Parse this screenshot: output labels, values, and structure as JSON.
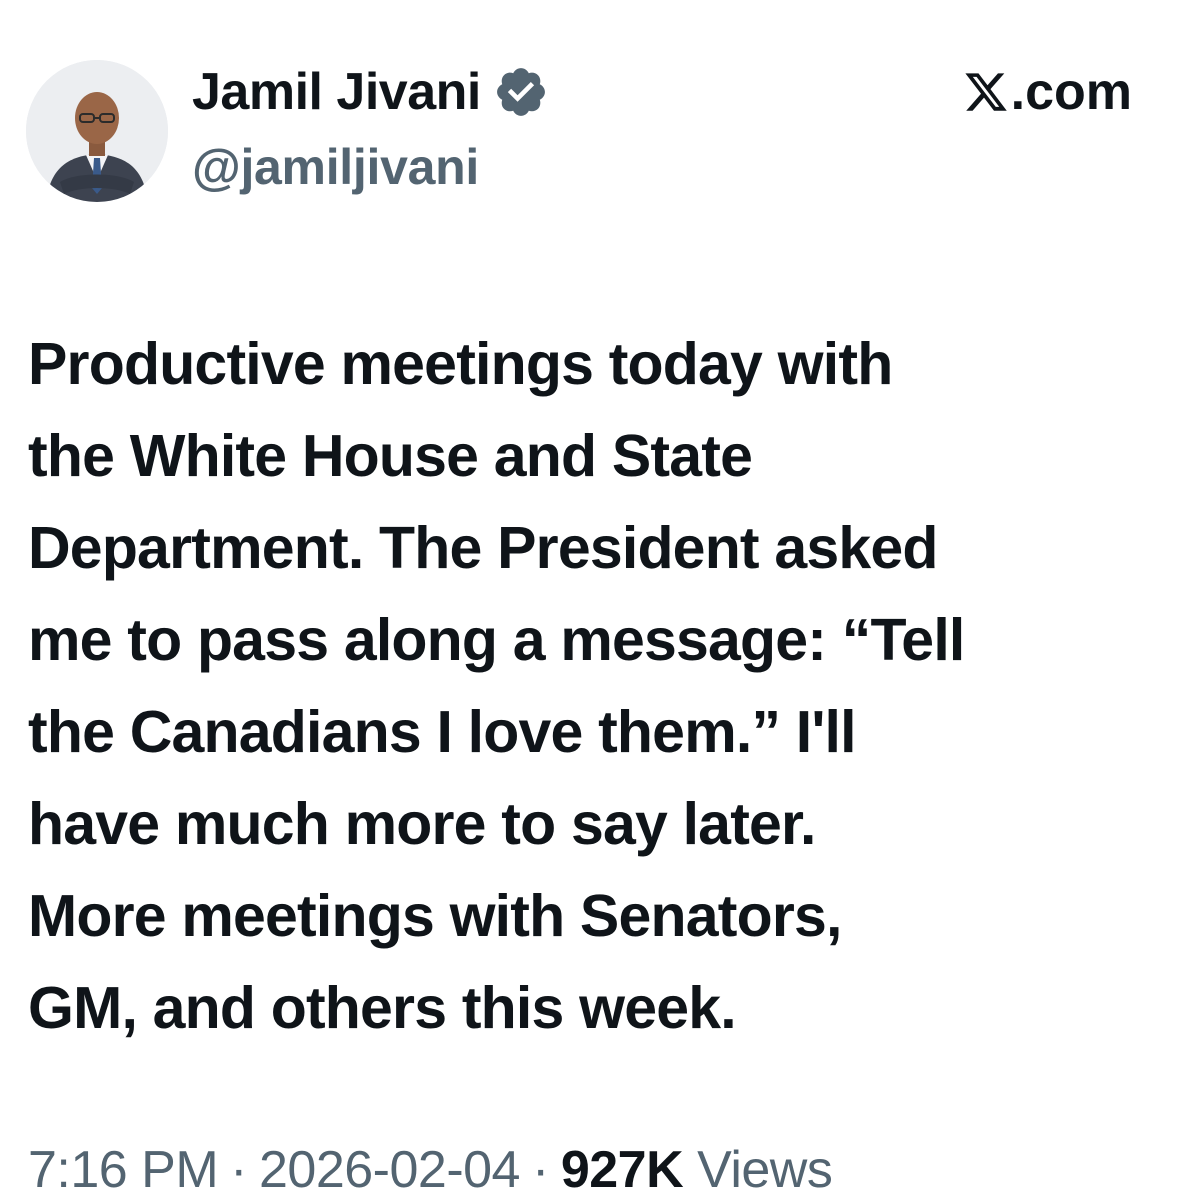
{
  "author": {
    "display_name": "Jamil Jivani",
    "handle": "@jamiljivani",
    "avatar_icon": "profile-photo",
    "verified_icon": "verified-badge-icon",
    "verified_color": "#536471"
  },
  "site": {
    "label": ".com",
    "logo_icon": "x-logo-icon"
  },
  "tweet": {
    "lines": [
      "Productive meetings today with",
      "the White House and State",
      "Department. The President asked",
      "me to pass along a message: “Tell",
      "the Canadians I love them.” I'll",
      "have much more to say later.",
      "More meetings with Senators,",
      "GM, and others this week."
    ]
  },
  "meta": {
    "time": "7:16 PM",
    "separator": "·",
    "date": "2026-02-04",
    "views_count": "927K",
    "views_label": "Views"
  },
  "colors": {
    "text_primary": "#0f1419",
    "text_secondary": "#536471",
    "background": "#ffffff"
  }
}
